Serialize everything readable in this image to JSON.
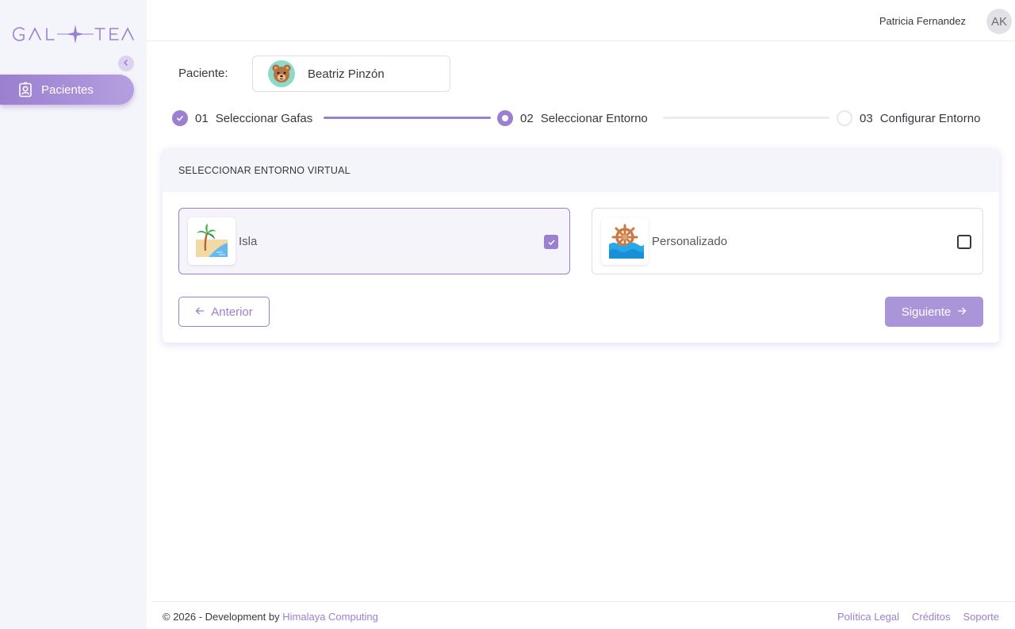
{
  "app": {
    "logo_text": "GAL+TEA"
  },
  "sidebar": {
    "collapse_icon": "chevron-left-icon",
    "items": [
      {
        "label": "Pacientes",
        "icon": "patient-badge-icon",
        "active": true
      }
    ]
  },
  "header": {
    "user_name": "Patricia Fernandez",
    "avatar_initials": "AK"
  },
  "patient": {
    "label": "Paciente:",
    "name": "Beatriz Pinzón",
    "avatar_icon": "bear-icon"
  },
  "stepper": {
    "steps": [
      {
        "number": "01",
        "label": "Seleccionar Gafas",
        "status": "done"
      },
      {
        "number": "02",
        "label": "Seleccionar Entorno",
        "status": "active"
      },
      {
        "number": "03",
        "label": "Configurar Entorno",
        "status": "pending"
      }
    ]
  },
  "card": {
    "title": "SELECCIONAR ENTORNO VIRTUAL",
    "options": [
      {
        "label": "Isla",
        "icon": "island-icon",
        "checked": true
      },
      {
        "label": "Personalizado",
        "icon": "ship-wheel-icon",
        "checked": false
      }
    ],
    "prev_label": "Anterior",
    "next_label": "Siguiente"
  },
  "footer": {
    "copyright": "© 2026 - Development by",
    "company": "Himalaya Computing",
    "links": [
      "Política Legal",
      "Créditos",
      "Soporte"
    ]
  },
  "colors": {
    "accent": "#9b7fd0",
    "sidebar_bg": "#f4f5fa"
  }
}
